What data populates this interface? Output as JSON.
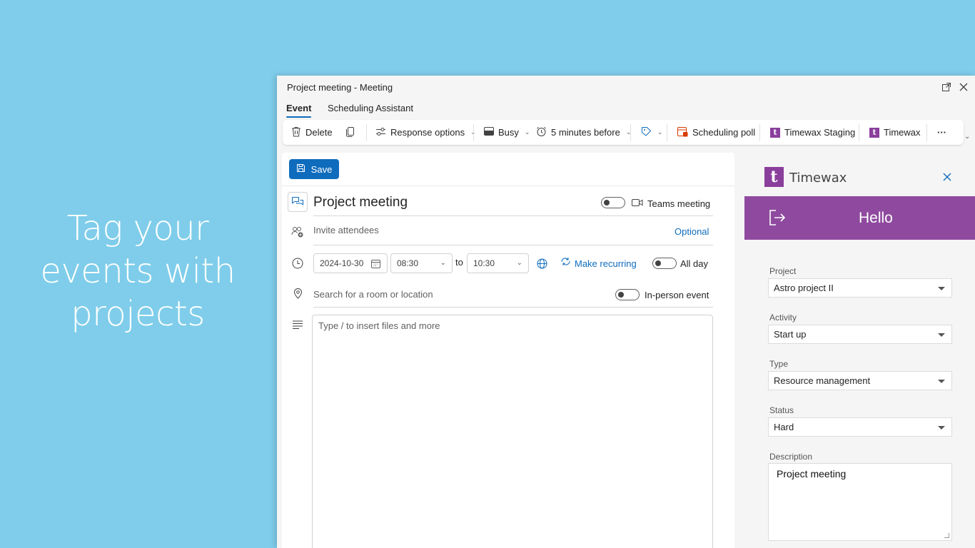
{
  "promo": {
    "lines": [
      "Tag your",
      "events with",
      "projects"
    ]
  },
  "window": {
    "title": "Project meeting - Meeting",
    "tabs": [
      {
        "label": "Event",
        "active": true
      },
      {
        "label": "Scheduling Assistant",
        "active": false
      }
    ]
  },
  "ribbon": {
    "delete": "Delete",
    "response_options": "Response options",
    "busy": "Busy",
    "reminder": "5 minutes before",
    "scheduling_poll": "Scheduling poll",
    "timewax_staging": "Timewax Staging",
    "timewax": "Timewax",
    "more": "···"
  },
  "compose": {
    "save": "Save",
    "subject": "Project meeting",
    "teams_meeting": "Teams meeting",
    "invite_placeholder": "Invite attendees",
    "optional": "Optional",
    "date": "2024-10-30",
    "start_time": "08:30",
    "to": "to",
    "end_time": "10:30",
    "make_recurring": "Make recurring",
    "all_day": "All day",
    "location_placeholder": "Search for a room or location",
    "in_person": "In-person event",
    "body_placeholder": "Type / to insert files and more"
  },
  "addin": {
    "logo_letter": "t",
    "title": "Timewax",
    "hello": "Hello",
    "project_label": "Project",
    "project_value": "Astro project II",
    "activity_label": "Activity",
    "activity_value": "Start up",
    "type_label": "Type",
    "type_value": "Resource management",
    "status_label": "Status",
    "status_value": "Hard",
    "description_label": "Description",
    "description_value": "Project meeting"
  },
  "colors": {
    "accent": "#0f6cbd",
    "timewax_purple": "#8f4a9f",
    "background": "#7fcdea"
  }
}
